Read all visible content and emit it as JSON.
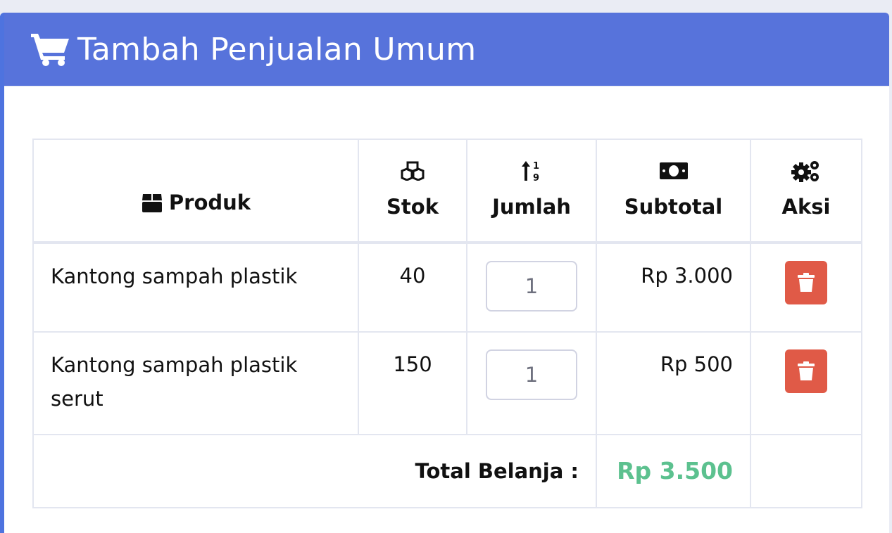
{
  "header": {
    "title": "Tambah Penjualan Umum",
    "icon": "shopping-cart-icon"
  },
  "table": {
    "columns": [
      {
        "label": "Produk",
        "icon": "box-icon"
      },
      {
        "label": "Stok",
        "icon": "cubes-icon"
      },
      {
        "label": "Jumlah",
        "icon": "sort-numeric-up-icon"
      },
      {
        "label": "Subtotal",
        "icon": "money-bill-icon"
      },
      {
        "label": "Aksi",
        "icon": "cogs-icon"
      }
    ],
    "rows": [
      {
        "produk": "Kantong sampah plastik",
        "stok": "40",
        "jumlah": "1",
        "subtotal": "Rp 3.000"
      },
      {
        "produk": "Kantong sampah plastik serut",
        "stok": "150",
        "jumlah": "1",
        "subtotal": "Rp 500"
      }
    ],
    "total": {
      "label": "Total Belanja :",
      "value": "Rp 3.500"
    }
  },
  "colors": {
    "header_bg": "#5773db",
    "delete_button": "#e05a47",
    "total_value": "#5cc18f"
  }
}
